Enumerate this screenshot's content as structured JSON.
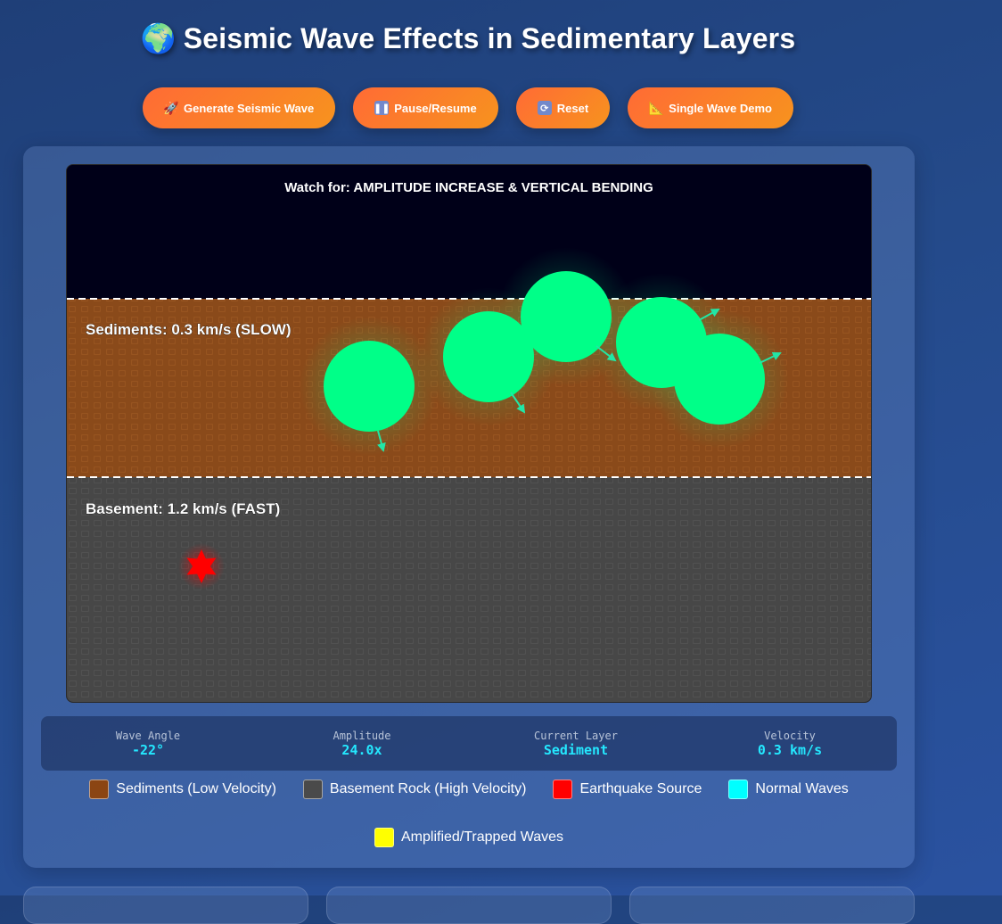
{
  "page_title": "Seismic Wave Effects in Sedimentary Layers",
  "title_icon": "globe-icon",
  "toolbar": {
    "generate_label": "Generate Seismic Wave",
    "generate_icon": "rocket-icon",
    "pause_label": "Pause/Resume",
    "pause_icon": "pause-icon",
    "reset_label": "Reset",
    "reset_icon": "refresh-icon",
    "demo_label": "Single Wave Demo",
    "demo_icon": "ruler-icon",
    "button_color_start": "#ff6b35",
    "button_color_end": "#f7931e"
  },
  "simulation": {
    "banner": "Watch for: AMPLITUDE INCREASE & VERTICAL BENDING",
    "sediment_label": "Sediments: 0.3 km/s (SLOW)",
    "basement_label": "Basement: 1.2 km/s (FAST)",
    "sky_color": "#000018",
    "sediment_color": "#8b4513",
    "basement_color": "#4a4a4a",
    "wave_color": "#00ff88",
    "source_color": "#ff0000",
    "source_icon": "star-burst-icon"
  },
  "stats": {
    "angle_label": "Wave Angle",
    "angle_value": "-22°",
    "amplitude_label": "Amplitude",
    "amplitude_value": "24.0x",
    "layer_label": "Current Layer",
    "layer_value": "Sediment",
    "velocity_label": "Velocity",
    "velocity_value": "0.3 km/s"
  },
  "legend": [
    {
      "label": "Sediments (Low Velocity)",
      "color": "#8b4513"
    },
    {
      "label": "Basement Rock (High Velocity)",
      "color": "#4a4a4a"
    },
    {
      "label": "Earthquake Source",
      "color": "#ff0000"
    },
    {
      "label": "Normal Waves",
      "color": "#00ffff"
    },
    {
      "label": "Amplified/Trapped Waves",
      "color": "#ffff00"
    }
  ]
}
